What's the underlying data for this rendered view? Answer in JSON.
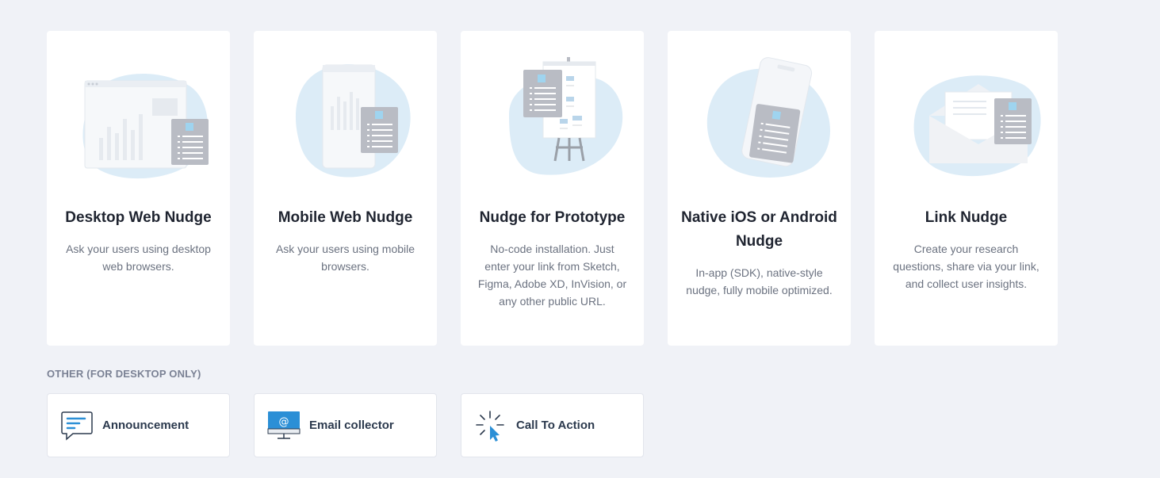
{
  "cards": [
    {
      "title": "Desktop Web Nudge",
      "description": "Ask your users using desktop web browsers.",
      "illustration": "desktop-browser-survey"
    },
    {
      "title": "Mobile Web Nudge",
      "description": "Ask your users using mobile browsers.",
      "illustration": "mobile-browser-survey"
    },
    {
      "title": "Nudge for Prototype",
      "description": "No-code installation. Just enter your link from Sketch, Figma, Adobe XD, InVision, or any other public URL.",
      "illustration": "prototype-easel-survey"
    },
    {
      "title": "Native iOS or Android Nudge",
      "description": "In-app (SDK), native-style nudge, fully mobile optimized.",
      "illustration": "native-phone-survey"
    },
    {
      "title": "Link Nudge",
      "description": "Create your research questions, share via your link, and collect user insights.",
      "illustration": "envelope-link-survey"
    }
  ],
  "other_section": {
    "label": "OTHER (FOR DESKTOP ONLY)",
    "items": [
      {
        "label": "Announcement",
        "icon": "announcement-chat-icon"
      },
      {
        "label": "Email collector",
        "icon": "email-monitor-icon"
      },
      {
        "label": "Call To Action",
        "icon": "cursor-click-icon"
      }
    ]
  },
  "colors": {
    "background": "#f0f2f7",
    "card": "#ffffff",
    "blob": "#dcecf7",
    "doc_gray": "#b9bcc4",
    "accent_blue": "#9fd4ef",
    "icon_blue": "#2b8fd6"
  }
}
